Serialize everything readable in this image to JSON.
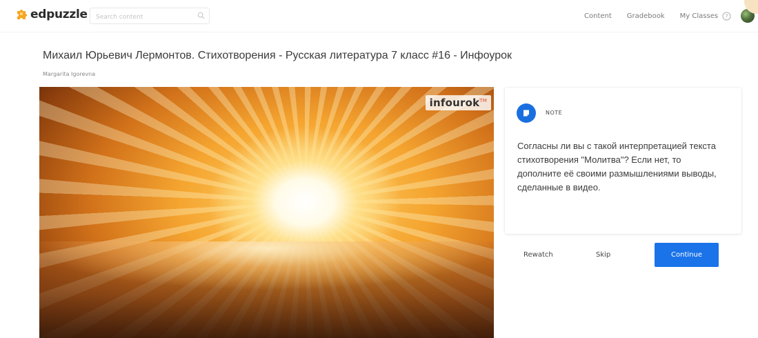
{
  "header": {
    "logo_text": "edpuzzle",
    "search_placeholder": "Search content",
    "nav": [
      "Content",
      "Gradebook",
      "My Classes"
    ],
    "help_icon": "question-circle-icon"
  },
  "video": {
    "title": "Михаил Юрьевич Лермонтов. Стихотворения - Русская литература 7 класс #16 - Инфоурок",
    "author": "Margarita Igorevna",
    "watermark": "infourok",
    "watermark_tm": "TM"
  },
  "note": {
    "label": "NOTE",
    "text": "Согласны ли вы с такой интерпретацией текста стихотворения \"Молитва\"? Если нет, то дополните её своими размышлениями выводы, сделанные в видео."
  },
  "actions": {
    "rewatch": "Rewatch",
    "skip": "Skip",
    "continue": "Continue"
  },
  "colors": {
    "accent": "#1a73e8",
    "logo_orange": "#f5a623"
  }
}
